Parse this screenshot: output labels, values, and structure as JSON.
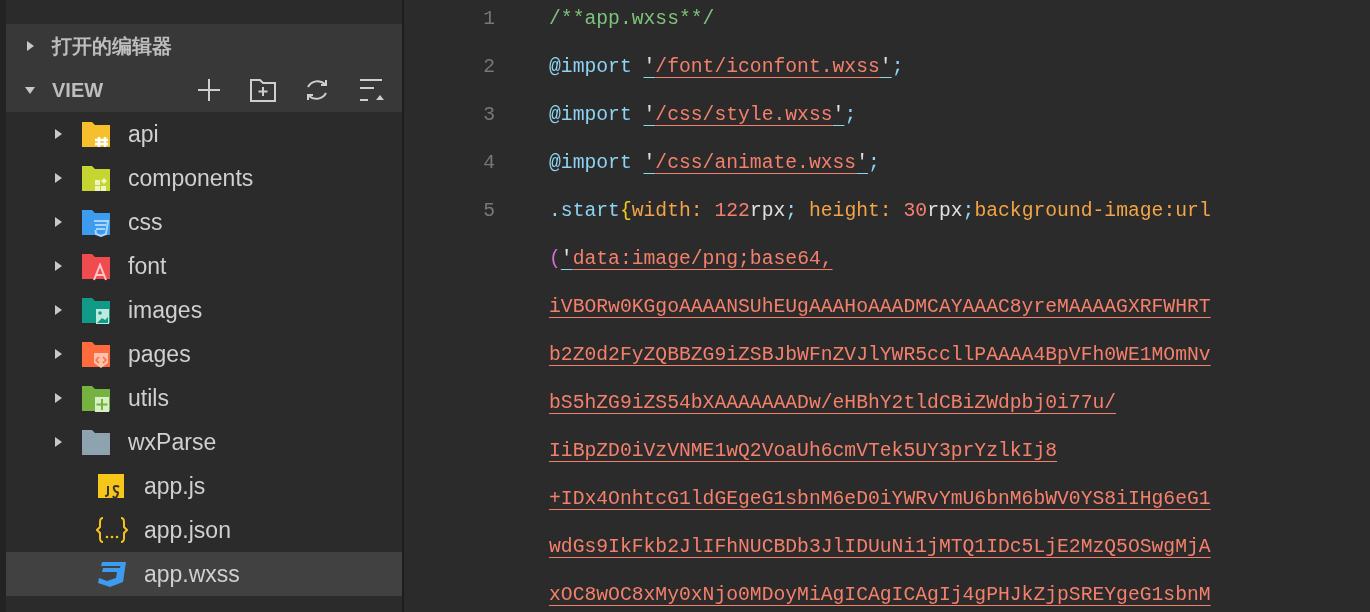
{
  "sidebar": {
    "sections": [
      {
        "title": "打开的编辑器",
        "expanded": false
      },
      {
        "title": "VIEW",
        "expanded": true
      }
    ],
    "items": [
      {
        "label": "api",
        "kind": "folder",
        "expanded": false,
        "color": "#f6bf2b",
        "selected": false
      },
      {
        "label": "components",
        "kind": "folder",
        "expanded": false,
        "color": "#c5d532",
        "selected": false
      },
      {
        "label": "css",
        "kind": "folder",
        "expanded": false,
        "color": "#3d9cf0",
        "selected": false
      },
      {
        "label": "font",
        "kind": "folder",
        "expanded": false,
        "color": "#f04b4f",
        "selected": false
      },
      {
        "label": "images",
        "kind": "folder",
        "expanded": false,
        "color": "#129a88",
        "selected": false
      },
      {
        "label": "pages",
        "kind": "folder",
        "expanded": false,
        "color": "#ff6b3d",
        "selected": false
      },
      {
        "label": "utils",
        "kind": "folder",
        "expanded": false,
        "color": "#75b23f",
        "selected": false
      },
      {
        "label": "wxParse",
        "kind": "folder",
        "expanded": false,
        "color": "#8fa2b0",
        "selected": false
      },
      {
        "label": "app.js",
        "kind": "js",
        "selected": false
      },
      {
        "label": "app.json",
        "kind": "json",
        "selected": false
      },
      {
        "label": "app.wxss",
        "kind": "css",
        "selected": true
      }
    ]
  },
  "editor": {
    "rows": [
      {
        "number": "1",
        "tokens": [
          {
            "text": "/**app.wxss**/",
            "kind": "comment"
          }
        ]
      },
      {
        "number": "2",
        "tokens": [
          {
            "text": "@import",
            "kind": "keyword"
          },
          {
            "text": "'",
            "kind": "quote"
          },
          {
            "text": "/font/iconfont.wxss",
            "kind": "string"
          },
          {
            "text": "'",
            "kind": "quote"
          },
          {
            "text": ";",
            "kind": "punct"
          }
        ]
      },
      {
        "number": "3",
        "tokens": [
          {
            "text": "@import",
            "kind": "keyword"
          },
          {
            "text": "'",
            "kind": "quote"
          },
          {
            "text": "/css/style.wxss",
            "kind": "string"
          },
          {
            "text": "'",
            "kind": "quote"
          },
          {
            "text": ";",
            "kind": "punct"
          }
        ]
      },
      {
        "number": "4",
        "tokens": [
          {
            "text": "@import",
            "kind": "keyword"
          },
          {
            "text": "'",
            "kind": "quote"
          },
          {
            "text": "/css/animate.wxss",
            "kind": "string"
          },
          {
            "text": "'",
            "kind": "quote"
          },
          {
            "text": ";",
            "kind": "punct"
          }
        ]
      },
      {
        "number": "5",
        "tokens": [
          {
            "text": ".start",
            "kind": "selector"
          },
          {
            "text": "{",
            "kind": "brace"
          },
          {
            "text": "width:",
            "kind": "property"
          },
          {
            "text": " 122",
            "kind": "number"
          },
          {
            "text": "rpx",
            "kind": "unit"
          },
          {
            "text": ";",
            "kind": "punct"
          },
          {
            "text": " height:",
            "kind": "property"
          },
          {
            "text": " 30",
            "kind": "number"
          },
          {
            "text": "rpx",
            "kind": "unit"
          },
          {
            "text": ";",
            "kind": "punct"
          },
          {
            "text": "background-image:url",
            "kind": "property"
          }
        ]
      },
      {
        "tokens": [
          {
            "text": "(",
            "kind": "paren"
          },
          {
            "text": "'",
            "kind": "quote"
          },
          {
            "text": "data:image/png;base64,",
            "kind": "string"
          }
        ]
      },
      {
        "tokens": [
          {
            "text": "iVBORw0KGgoAAAANSUhEUgAAAHoAAADMCAYAAAC8yreMAAAAGXRFWHRT",
            "kind": "string"
          }
        ]
      },
      {
        "tokens": [
          {
            "text": "b2Z0d2FyZQBBZG9iZSBJbWFnZVJlYWR5ccllPAAAA4BpVFh0WE1MOmNv",
            "kind": "string"
          }
        ]
      },
      {
        "tokens": [
          {
            "text": "bS5hZG9iZS54bXAAAAAAADw/eHBhY2tldCBiZWdpbj0i77u/",
            "kind": "string"
          }
        ]
      },
      {
        "tokens": [
          {
            "text": "IiBpZD0iVzVNME1wQ2VoaUh6cmVTek5UY3prYzlkIj8",
            "kind": "string"
          }
        ]
      },
      {
        "tokens": [
          {
            "text": "+IDx4OnhtcG1ldGEgeG1sbnM6eD0iYWRvYmU6bnM6bWV0YS8iIHg6eG1",
            "kind": "string"
          }
        ]
      },
      {
        "tokens": [
          {
            "text": "wdGs9IkFkb2JlIFhNUCBDb3JlIDUuNi1jMTQ1IDc5LjE2MzQ5OSwgMjA",
            "kind": "string"
          }
        ]
      },
      {
        "tokens": [
          {
            "text": "xOC8wOC8xMy0xNjo0MDoyMiAgICAgICAgIj4gPHJkZjpSREYgeG1sbnM",
            "kind": "string"
          }
        ]
      }
    ]
  }
}
